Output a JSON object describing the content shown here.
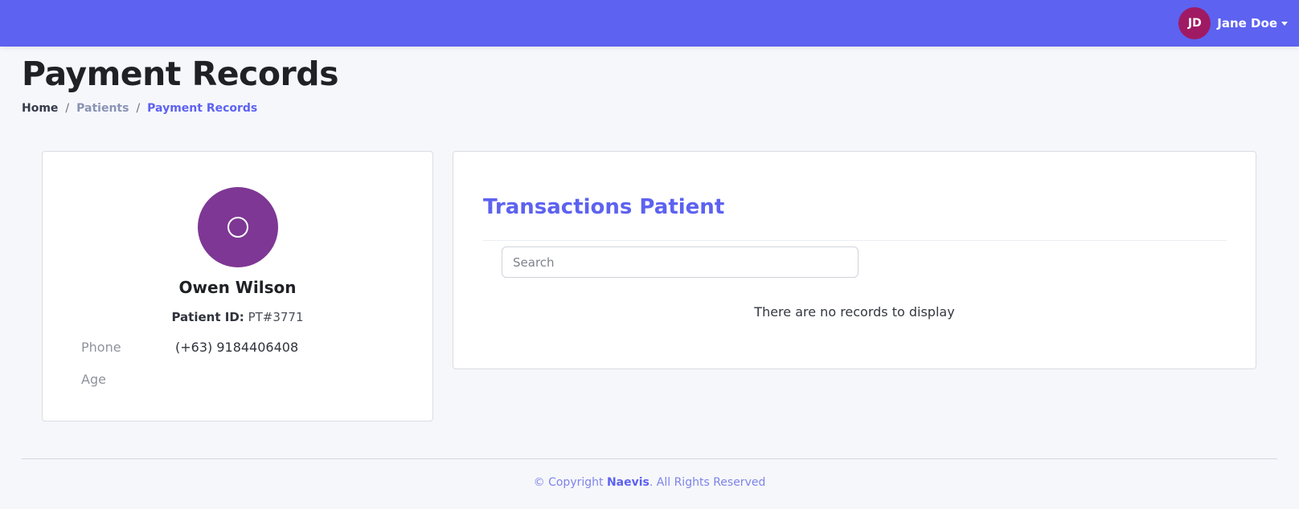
{
  "topbar": {
    "user": {
      "initials": "JD",
      "name": "Jane Doe",
      "avatar_color": "#a01a63"
    },
    "bg_color": "#5d62f0"
  },
  "page": {
    "title": "Payment Records",
    "breadcrumb": [
      "Home",
      "Patients",
      "Payment Records"
    ],
    "breadcrumb_separator": "/"
  },
  "patient": {
    "avatar_icon": "circle-icon",
    "avatar_color": "#7e3794",
    "name": "Owen Wilson",
    "id_label": "Patient ID:",
    "id_value": "PT#3771",
    "phone_label": "Phone",
    "phone_value": "(+63) 9184406408",
    "age_label": "Age",
    "age_value": ""
  },
  "transactions": {
    "title": "Transactions Patient",
    "search_placeholder": "Search",
    "empty_message": "There are no records to display"
  },
  "footer": {
    "prefix": "© Copyright ",
    "brand": "Naevis",
    "suffix": ". All Rights Reserved"
  }
}
